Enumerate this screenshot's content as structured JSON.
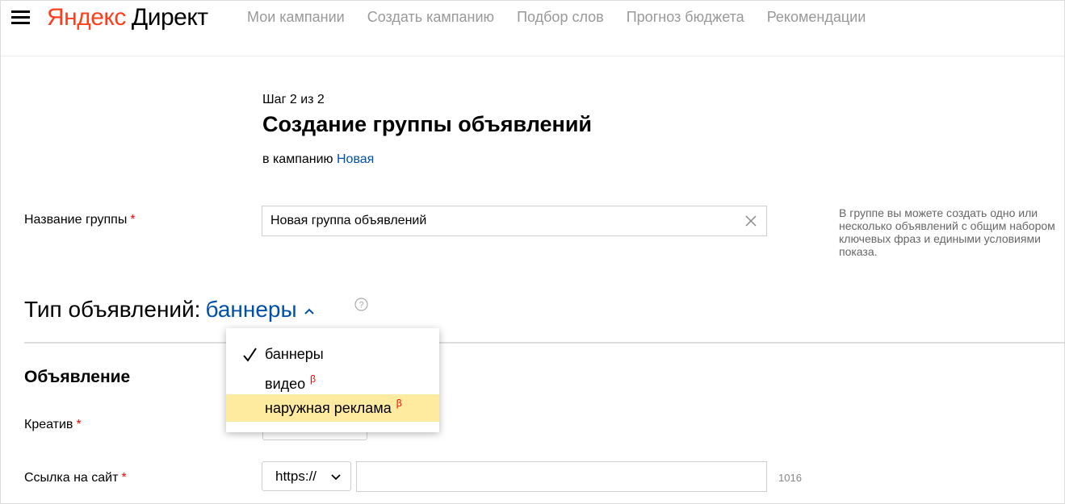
{
  "header": {
    "logo_part1": "Яндекс",
    "logo_part2": "Директ",
    "nav": [
      {
        "label": "Мои кампании"
      },
      {
        "label": "Создать кампанию"
      },
      {
        "label": "Подбор слов"
      },
      {
        "label": "Прогноз бюджета"
      },
      {
        "label": "Рекомендации"
      }
    ]
  },
  "step": {
    "indicator": "Шаг 2 из 2",
    "title": "Создание группы объявлений",
    "campaign_prefix": "в кампанию",
    "campaign_name": "Новая"
  },
  "group": {
    "label": "Название группы",
    "required_mark": "*",
    "value": "Новая группа объявлений",
    "hint": "В группе вы можете создать одно или несколько объявлений с общим набором ключевых фраз и едиными условиями показа."
  },
  "ad_type": {
    "label": "Тип объявлений:",
    "value": "баннеры",
    "options": [
      {
        "label": "баннеры",
        "selected": true,
        "beta": ""
      },
      {
        "label": "видео",
        "selected": false,
        "beta": "β"
      },
      {
        "label": "наружная реклама",
        "selected": false,
        "beta": "β"
      }
    ]
  },
  "ad": {
    "section_title": "Объявление",
    "creative_label": "Креатив",
    "link_label": "Ссылка на сайт",
    "required_mark": "*",
    "protocol": "https://",
    "url_value": "",
    "url_counter": "1016"
  },
  "colors": {
    "brand_red": "#fc3f1d",
    "link_blue": "#0050a8",
    "highlight": "#ffeba0",
    "required": "#ff0000"
  }
}
